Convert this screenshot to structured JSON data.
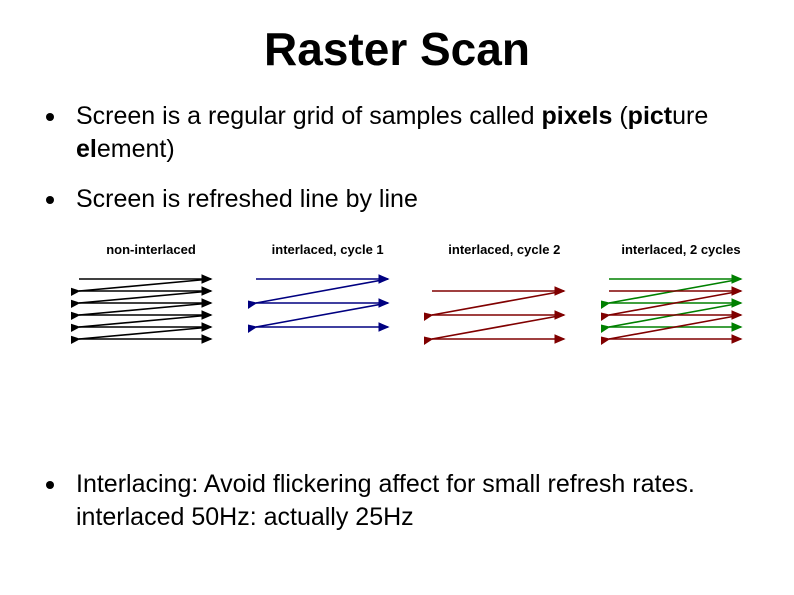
{
  "title": "Raster Scan",
  "bullets": [
    {
      "prefix": "Screen is a regular grid of samples  called ",
      "bold1": "pixels",
      "mid": " (",
      "bold2": "pict",
      "mid2": "ure ",
      "bold3": "el",
      "suffix": "ement)"
    },
    {
      "text": "Screen is refreshed line by line"
    }
  ],
  "diagrams": [
    {
      "label": "non-interlaced"
    },
    {
      "label": "interlaced, cycle 1"
    },
    {
      "label": "interlaced, cycle 2"
    },
    {
      "label": "interlaced, 2 cycles"
    }
  ],
  "bottom": {
    "line1": "Interlacing: Avoid flickering affect for small refresh rates.",
    "line2": "interlaced 50Hz: actually 25Hz"
  },
  "colors": {
    "dark": "#000000",
    "navy": "#000080",
    "maroon": "#800000",
    "green": "#008000"
  }
}
